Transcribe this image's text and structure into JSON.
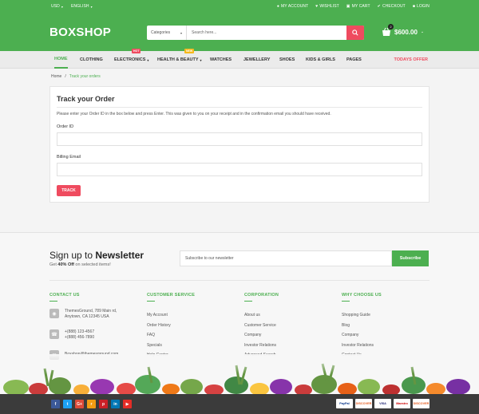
{
  "topbar": {
    "currency": "USD",
    "language": "ENGLISH",
    "links": [
      {
        "icon": "user-icon",
        "label": "MY ACCOUNT"
      },
      {
        "icon": "heart-icon",
        "label": "WISHLIST"
      },
      {
        "icon": "cart-icon",
        "label": "MY CART"
      },
      {
        "icon": "check-icon",
        "label": "CHECKOUT"
      },
      {
        "icon": "lock-icon",
        "label": "LOGIN"
      }
    ]
  },
  "header": {
    "logo": "BOXSHOP",
    "search": {
      "category": "Categories",
      "placeholder": "Search here..."
    },
    "cart": {
      "count": "2",
      "total": "$600.00"
    }
  },
  "nav": {
    "items": [
      {
        "label": "HOME",
        "active": true
      },
      {
        "label": "CLOTHING"
      },
      {
        "label": "ELECTRONICS",
        "tag": "HOT",
        "tag_color": "#ef4b5f"
      },
      {
        "label": "HEALTH & BEAUTY",
        "tag": "NEW",
        "tag_color": "#f5b81c"
      },
      {
        "label": "WATCHES"
      },
      {
        "label": "JEWELLERY"
      },
      {
        "label": "SHOES"
      },
      {
        "label": "KIDS & GIRLS"
      },
      {
        "label": "PAGES"
      }
    ],
    "special": "TODAYS OFFER"
  },
  "breadcrumb": {
    "home": "Home",
    "separator": "/",
    "current": "Track your orders"
  },
  "track": {
    "title": "Track your Order",
    "description": "Please enter your Order ID in the box below and press Enter. This was given to you on your receipt and in the confirmation email you should have received.",
    "order_id_label": "Order ID",
    "billing_email_label": "Billing Email",
    "button": "TRACK"
  },
  "newsletter": {
    "title_prefix": "Sign up to",
    "title_bold": "Newsletter",
    "sub_prefix": "Get",
    "sub_bold": "40% Off",
    "sub_suffix": "on selected items!",
    "placeholder": "Subscribe to our newsletter",
    "button": "Subscribe"
  },
  "footer": {
    "contact": {
      "title": "CONTACT US",
      "address": [
        "ThemesGround, 789 Main rd,",
        "Anytown, CA 12345 USA"
      ],
      "phone": [
        "+(888) 123-4567",
        "+(888) 456-7890"
      ],
      "email": "Boxshop@themesground.com"
    },
    "customer_service": {
      "title": "CUSTOMER SERVICE",
      "links": [
        "My Account",
        "Order History",
        "FAQ",
        "Specials",
        "Help Center"
      ]
    },
    "corporation": {
      "title": "CORPORATION",
      "links": [
        "About us",
        "Customer Service",
        "Company",
        "Investor Relations",
        "Advanced Search"
      ]
    },
    "why_choose": {
      "title": "WHY CHOOSE US",
      "links": [
        "Shopping Guide",
        "Blog",
        "Company",
        "Investor Relations",
        "Contact Us"
      ]
    }
  },
  "bottom": {
    "social": [
      {
        "icon": "facebook-icon",
        "glyph": "f",
        "color": "#3b5998"
      },
      {
        "icon": "twitter-icon",
        "glyph": "t",
        "color": "#1da1f2"
      },
      {
        "icon": "google-plus-icon",
        "glyph": "G+",
        "color": "#dd4b39"
      },
      {
        "icon": "rss-icon",
        "glyph": "r",
        "color": "#f39c12"
      },
      {
        "icon": "pinterest-icon",
        "glyph": "p",
        "color": "#cb2027"
      },
      {
        "icon": "linkedin-icon",
        "glyph": "in",
        "color": "#0077b5"
      },
      {
        "icon": "youtube-icon",
        "glyph": "▶",
        "color": "#e52d27"
      }
    ],
    "payments": [
      {
        "label": "PayPal",
        "color": "#003087"
      },
      {
        "label": "DISCOVER",
        "color": "#e55c20"
      },
      {
        "label": "VISA",
        "color": "#1a1f71"
      },
      {
        "label": "Maestro",
        "color": "#cc0000"
      },
      {
        "label": "DISCOVER",
        "color": "#e55c20"
      }
    ]
  }
}
